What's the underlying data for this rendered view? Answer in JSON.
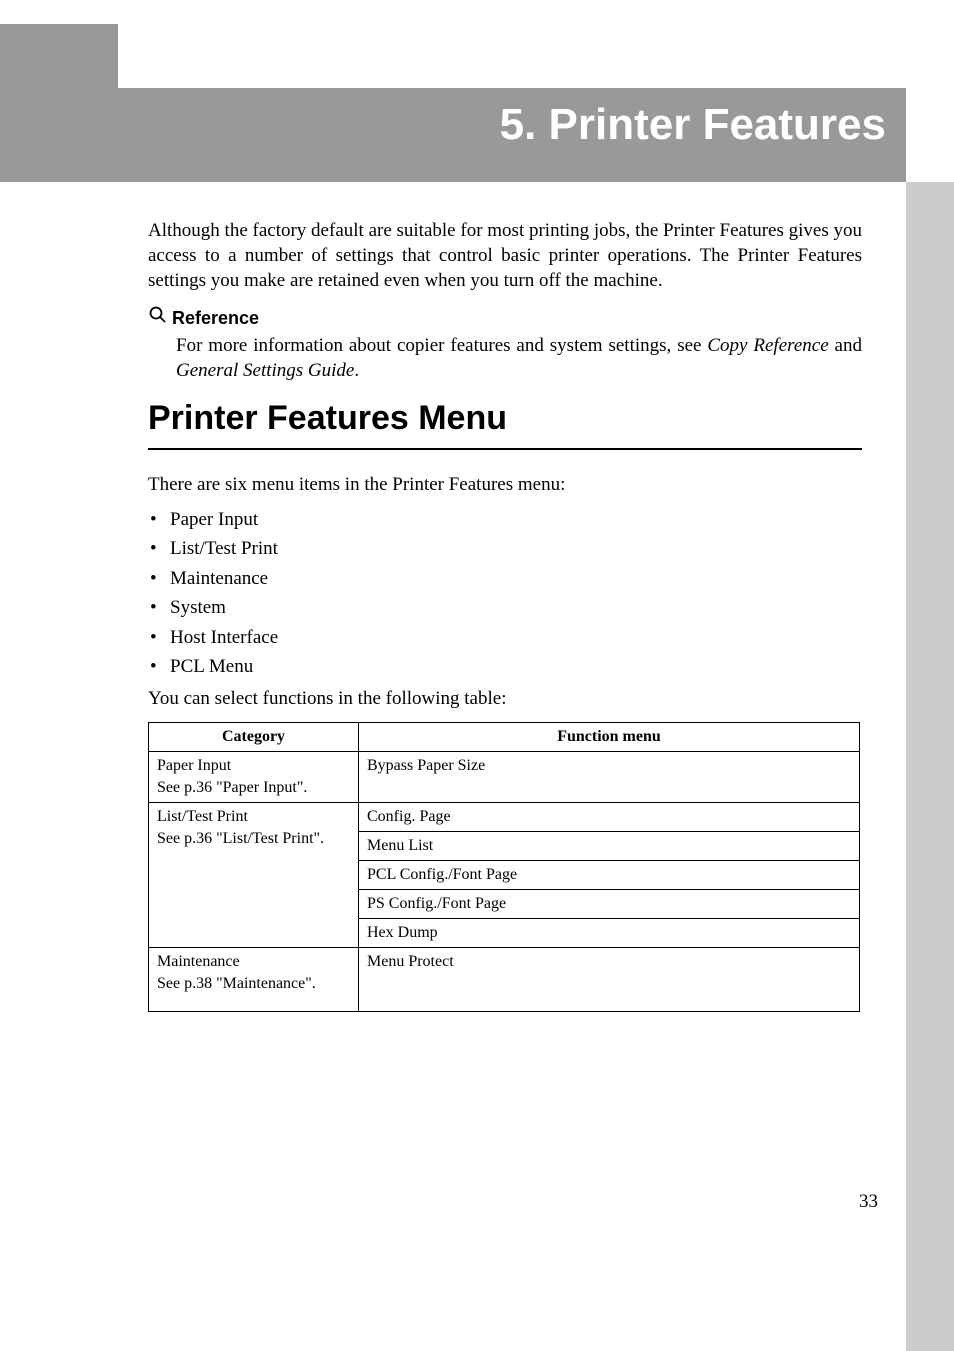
{
  "chapter": {
    "number": "5.",
    "title": "Printer Features"
  },
  "intro": "Although the factory default are suitable for most printing jobs, the Printer Features gives you access to a number of settings that control basic printer operations. The Printer Features settings you make are retained even when you turn off the machine.",
  "reference": {
    "heading": "Reference",
    "body_prefix": "For more information about copier features and system settings, see ",
    "copy_ref": "Copy Reference",
    "and_word": " and ",
    "gsg": "General Settings Guide",
    "suffix": "."
  },
  "section_title": "Printer Features Menu",
  "menu_intro": "There are six menu items in the Printer Features menu:",
  "menu_items": [
    "Paper Input",
    "List/Test Print",
    "Maintenance",
    "System",
    "Host Interface",
    "PCL Menu"
  ],
  "table_intro": "You can select functions in the following table:",
  "table": {
    "headers": {
      "category": "Category",
      "function": "Function menu"
    },
    "rows": [
      {
        "cat_line1": "Paper Input",
        "cat_line2": "See p.36 \"Paper Input\".",
        "functions": [
          "Bypass Paper Size"
        ]
      },
      {
        "cat_line1": "List/Test Print",
        "cat_line2": "See p.36 \"List/Test Print\".",
        "functions": [
          "Config. Page",
          "Menu List",
          "PCL Config./Font Page",
          "PS Config./Font Page",
          "Hex Dump"
        ]
      },
      {
        "cat_line1": "Maintenance",
        "cat_line2": "See p.38 \"Maintenance\".",
        "functions": [
          "Menu Protect"
        ]
      }
    ]
  },
  "page_number": "33"
}
